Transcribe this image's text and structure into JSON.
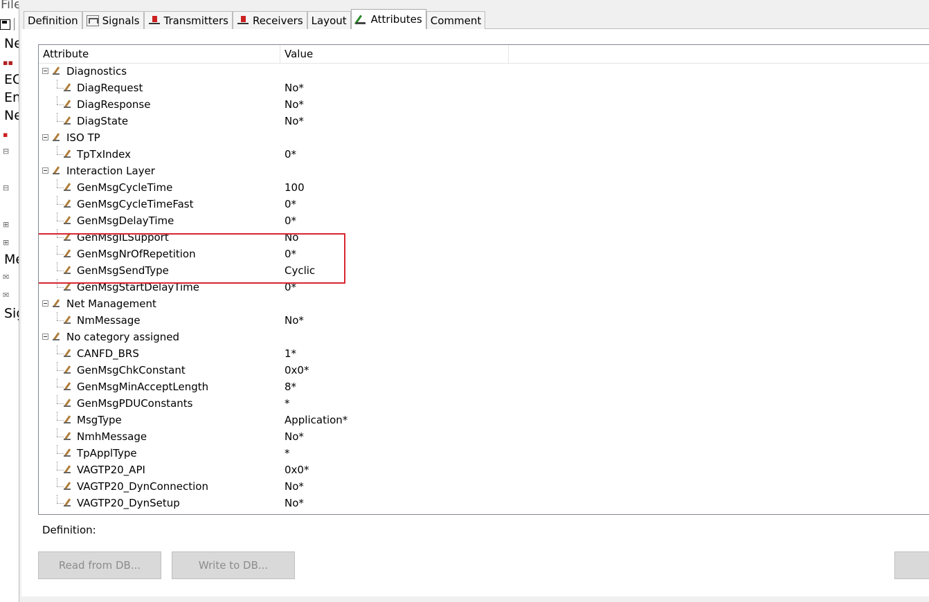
{
  "left_window": {
    "menu_file": "File",
    "items": [
      "Ne",
      "EC",
      "En",
      "Ne",
      "Me",
      "Sig"
    ]
  },
  "tabs": [
    {
      "label": "Definition",
      "icon": "none"
    },
    {
      "label": "Signals",
      "icon": "signal-icon"
    },
    {
      "label": "Transmitters",
      "icon": "transmitter-icon"
    },
    {
      "label": "Receivers",
      "icon": "receiver-icon"
    },
    {
      "label": "Layout",
      "icon": "none"
    },
    {
      "label": "Attributes",
      "icon": "attributes-icon",
      "active": true
    },
    {
      "label": "Comment",
      "icon": "none"
    }
  ],
  "table": {
    "col_attribute": "Attribute",
    "col_value": "Value",
    "rows": [
      {
        "type": "cat",
        "name": "Diagnostics",
        "value": ""
      },
      {
        "type": "leaf",
        "name": "DiagRequest",
        "value": "No*"
      },
      {
        "type": "leaf",
        "name": "DiagResponse",
        "value": "No*"
      },
      {
        "type": "leaf",
        "name": "DiagState",
        "value": "No*"
      },
      {
        "type": "cat",
        "name": "ISO TP",
        "value": ""
      },
      {
        "type": "leaf",
        "name": "TpTxIndex",
        "value": "0*"
      },
      {
        "type": "cat",
        "name": "Interaction Layer",
        "value": ""
      },
      {
        "type": "leaf",
        "name": "GenMsgCycleTime",
        "value": "100"
      },
      {
        "type": "leaf",
        "name": "GenMsgCycleTimeFast",
        "value": "0*"
      },
      {
        "type": "leaf",
        "name": "GenMsgDelayTime",
        "value": "0*"
      },
      {
        "type": "leaf",
        "name": "GenMsgILSupport",
        "value": "No"
      },
      {
        "type": "leaf",
        "name": "GenMsgNrOfRepetition",
        "value": "0*"
      },
      {
        "type": "leaf",
        "name": "GenMsgSendType",
        "value": "Cyclic"
      },
      {
        "type": "leaf",
        "name": "GenMsgStartDelayTime",
        "value": "0*"
      },
      {
        "type": "cat",
        "name": "Net Management",
        "value": ""
      },
      {
        "type": "leaf",
        "name": "NmMessage",
        "value": "No*"
      },
      {
        "type": "cat",
        "name": "No category assigned",
        "value": ""
      },
      {
        "type": "leaf",
        "name": "CANFD_BRS",
        "value": "1*"
      },
      {
        "type": "leaf",
        "name": "GenMsgChkConstant",
        "value": "0x0*"
      },
      {
        "type": "leaf",
        "name": "GenMsgMinAcceptLength",
        "value": "8*"
      },
      {
        "type": "leaf",
        "name": "GenMsgPDUConstants",
        "value": "*"
      },
      {
        "type": "leaf",
        "name": "MsgType",
        "value": "Application*"
      },
      {
        "type": "leaf",
        "name": "NmhMessage",
        "value": "No*"
      },
      {
        "type": "leaf",
        "name": "TpApplType",
        "value": "*"
      },
      {
        "type": "leaf",
        "name": "VAGTP20_API",
        "value": "0x0*"
      },
      {
        "type": "leaf",
        "name": "VAGTP20_DynConnection",
        "value": "No*"
      },
      {
        "type": "leaf",
        "name": "VAGTP20_DynSetup",
        "value": "No*"
      }
    ]
  },
  "definition_label": "Definition:",
  "buttons": {
    "read": "Read from DB...",
    "write": "Write to DB...",
    "right": ""
  },
  "colors": {
    "highlight": "#d9252f"
  }
}
